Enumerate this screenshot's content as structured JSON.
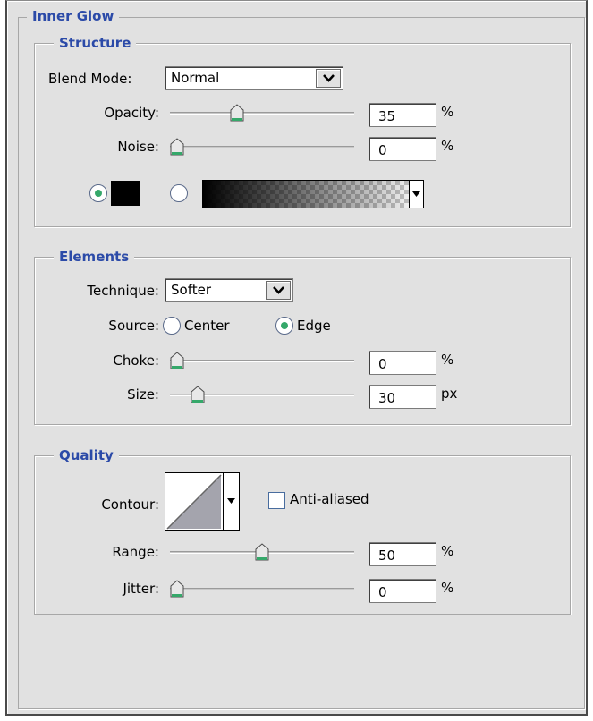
{
  "inner_glow": {
    "title": "Inner Glow",
    "structure": {
      "title": "Structure",
      "blend_mode": {
        "label": "Blend Mode:",
        "value": "Normal"
      },
      "opacity": {
        "label": "Opacity:",
        "value": "35",
        "unit": "%",
        "level": 0.35
      },
      "noise": {
        "label": "Noise:",
        "value": "0",
        "unit": "%",
        "level": 0.0
      },
      "color_mode": "solid",
      "solid_color": "#000000"
    },
    "elements": {
      "title": "Elements",
      "technique": {
        "label": "Technique:",
        "value": "Softer"
      },
      "source": {
        "label": "Source:",
        "options": [
          "Center",
          "Edge"
        ],
        "selected": "Edge"
      },
      "choke": {
        "label": "Choke:",
        "value": "0",
        "unit": "%",
        "level": 0.0
      },
      "size": {
        "label": "Size:",
        "value": "30",
        "unit": "px",
        "level": 0.12
      }
    },
    "quality": {
      "title": "Quality",
      "contour": {
        "label": "Contour:"
      },
      "anti_aliased": {
        "label": "Anti-aliased",
        "checked": false
      },
      "range": {
        "label": "Range:",
        "value": "50",
        "unit": "%",
        "level": 0.5
      },
      "jitter": {
        "label": "Jitter:",
        "value": "0",
        "unit": "%",
        "level": 0.0
      }
    }
  },
  "colors": {
    "accent": "#2b4aa8",
    "panel_bg": "#e1e1e1",
    "radio_dot": "#35a86a"
  },
  "icons": [
    "dropdown-arrow-icon",
    "slider-thumb-icon",
    "gradient-arrow-icon",
    "contour-curve-icon"
  ]
}
